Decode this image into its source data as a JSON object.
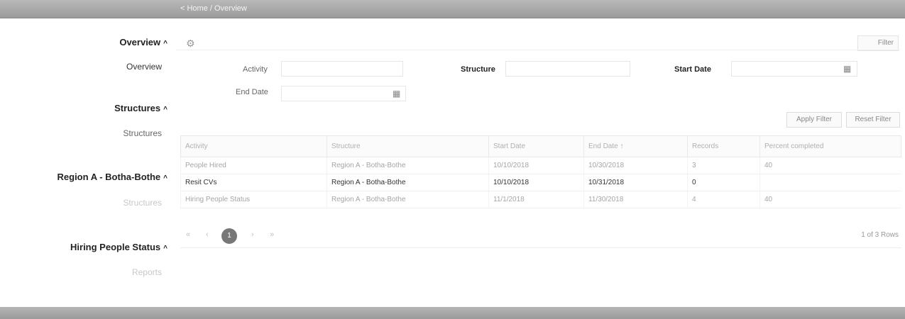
{
  "breadcrumb": "< Home / Overview",
  "sidebar": {
    "sections": [
      {
        "heading": "Overview",
        "item": "Overview"
      },
      {
        "heading": "Structures",
        "item": "Structures"
      },
      {
        "heading": "Region A - Botha-Bothe",
        "item": "Structures"
      },
      {
        "heading": "Hiring People Status",
        "item": "Reports"
      }
    ]
  },
  "toolbar": {
    "settings_icon": "gear-icon",
    "filter_label": "Filter"
  },
  "filters": {
    "activity_label": "Activity",
    "structure_label": "Structure",
    "start_date_label": "Start Date",
    "end_date_label": "End Date",
    "calendar_icon": "calendar-icon",
    "apply_label": "Apply Filter",
    "reset_label": "Reset Filter"
  },
  "table": {
    "headers": [
      "Activity",
      "Structure",
      "Start Date",
      "End Date ↑",
      "Records",
      "Percent completed"
    ],
    "rows": [
      [
        "People Hired",
        "Region A - Botha-Bothe",
        "10/10/2018",
        "10/30/2018",
        "3",
        "40"
      ],
      [
        "Resit CVs",
        "Region A - Botha-Bothe",
        "10/10/2018",
        "10/31/2018",
        "0",
        ""
      ],
      [
        "Hiring People Status",
        "Region A - Botha-Bothe",
        "11/1/2018",
        "11/30/2018",
        "4",
        "40"
      ]
    ]
  },
  "pagination": {
    "first": "«",
    "prev": "‹",
    "current": "1",
    "next": "›",
    "last": "»",
    "count_label": "1 of 3 Rows"
  }
}
